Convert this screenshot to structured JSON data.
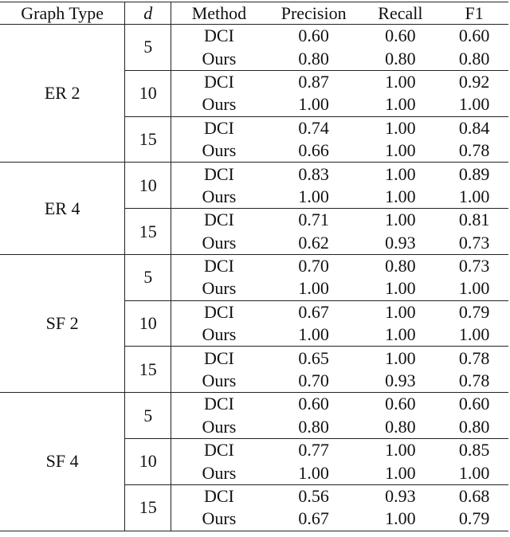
{
  "table": {
    "headers": {
      "graph_type": "Graph Type",
      "d": "d",
      "method": "Method",
      "precision": "Precision",
      "recall": "Recall",
      "f1": "F1"
    },
    "blocks": [
      {
        "graph_type": "ER 2",
        "groups": [
          {
            "d": "5",
            "rows": [
              {
                "method": "DCI",
                "precision": "0.60",
                "recall": "0.60",
                "f1": "0.60"
              },
              {
                "method": "Ours",
                "precision": "0.80",
                "recall": "0.80",
                "f1": "0.80"
              }
            ]
          },
          {
            "d": "10",
            "rows": [
              {
                "method": "DCI",
                "precision": "0.87",
                "recall": "1.00",
                "f1": "0.92"
              },
              {
                "method": "Ours",
                "precision": "1.00",
                "recall": "1.00",
                "f1": "1.00"
              }
            ]
          },
          {
            "d": "15",
            "rows": [
              {
                "method": "DCI",
                "precision": "0.74",
                "recall": "1.00",
                "f1": "0.84"
              },
              {
                "method": "Ours",
                "precision": "0.66",
                "recall": "1.00",
                "f1": "0.78"
              }
            ]
          }
        ]
      },
      {
        "graph_type": "ER 4",
        "groups": [
          {
            "d": "10",
            "rows": [
              {
                "method": "DCI",
                "precision": "0.83",
                "recall": "1.00",
                "f1": "0.89"
              },
              {
                "method": "Ours",
                "precision": "1.00",
                "recall": "1.00",
                "f1": "1.00"
              }
            ]
          },
          {
            "d": "15",
            "rows": [
              {
                "method": "DCI",
                "precision": "0.71",
                "recall": "1.00",
                "f1": "0.81"
              },
              {
                "method": "Ours",
                "precision": "0.62",
                "recall": "0.93",
                "f1": "0.73"
              }
            ]
          }
        ]
      },
      {
        "graph_type": "SF 2",
        "groups": [
          {
            "d": "5",
            "rows": [
              {
                "method": "DCI",
                "precision": "0.70",
                "recall": "0.80",
                "f1": "0.73"
              },
              {
                "method": "Ours",
                "precision": "1.00",
                "recall": "1.00",
                "f1": "1.00"
              }
            ]
          },
          {
            "d": "10",
            "rows": [
              {
                "method": "DCI",
                "precision": "0.67",
                "recall": "1.00",
                "f1": "0.79"
              },
              {
                "method": "Ours",
                "precision": "1.00",
                "recall": "1.00",
                "f1": "1.00"
              }
            ]
          },
          {
            "d": "15",
            "rows": [
              {
                "method": "DCI",
                "precision": "0.65",
                "recall": "1.00",
                "f1": "0.78"
              },
              {
                "method": "Ours",
                "precision": "0.70",
                "recall": "0.93",
                "f1": "0.78"
              }
            ]
          }
        ]
      },
      {
        "graph_type": "SF 4",
        "groups": [
          {
            "d": "5",
            "rows": [
              {
                "method": "DCI",
                "precision": "0.60",
                "recall": "0.60",
                "f1": "0.60"
              },
              {
                "method": "Ours",
                "precision": "0.80",
                "recall": "0.80",
                "f1": "0.80"
              }
            ]
          },
          {
            "d": "10",
            "rows": [
              {
                "method": "DCI",
                "precision": "0.77",
                "recall": "1.00",
                "f1": "0.85"
              },
              {
                "method": "Ours",
                "precision": "1.00",
                "recall": "1.00",
                "f1": "1.00"
              }
            ]
          },
          {
            "d": "15",
            "rows": [
              {
                "method": "DCI",
                "precision": "0.56",
                "recall": "0.93",
                "f1": "0.68"
              },
              {
                "method": "Ours",
                "precision": "0.67",
                "recall": "1.00",
                "f1": "0.79"
              }
            ]
          }
        ]
      }
    ]
  }
}
